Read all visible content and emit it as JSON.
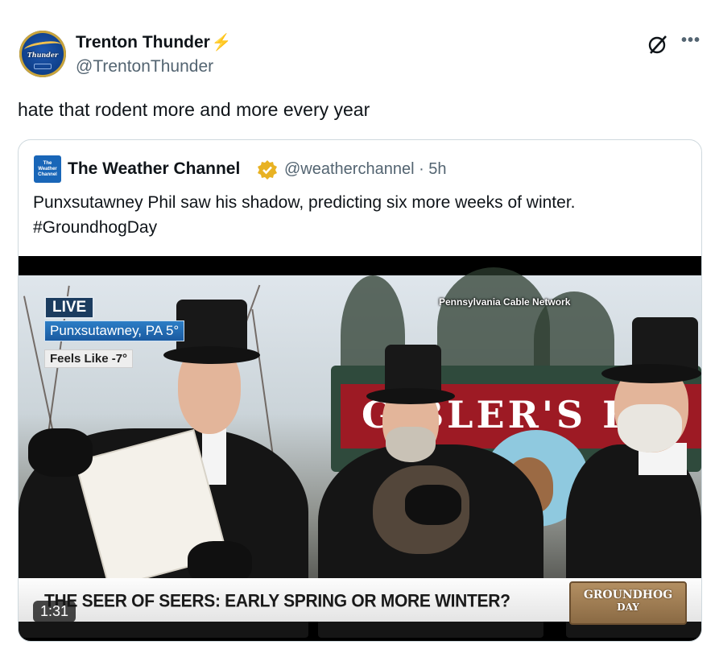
{
  "tweet": {
    "author_name": "Trenton Thunder",
    "author_handle": "@TrentonThunder",
    "avatar_logo_text": "Thunder",
    "name_emoji": "⚡",
    "text": "hate that rodent more and more every year"
  },
  "header_icons": {
    "grok": "grok-icon",
    "more": "more-icon"
  },
  "quoted": {
    "author_name": "The Weather Channel",
    "avatar_text": [
      "The",
      "Weather",
      "Channel"
    ],
    "verified": "verified-badge-icon",
    "handle_time": "@weatherchannel · 5h",
    "text_line1": "Punxsutawney Phil saw his shadow, predicting six more weeks of winter.",
    "text_line2": "#GroundhogDay",
    "video": {
      "live_label": "LIVE",
      "location": "Punxsutawney, PA  5°",
      "feels_like": "Feels Like -7°",
      "network_credit": "Pennsylvania Cable Network",
      "sign_text": "G  BLER'S K",
      "lower_third": "THE SEER OF SEERS: EARLY SPRING OR MORE WINTER?",
      "logo_line1": "GROUNDHOG",
      "logo_line2": "DAY",
      "duration": "1:31"
    }
  },
  "colors": {
    "text": "#0f1419",
    "muted": "#536471",
    "border": "#cfd9de",
    "bolt": "#f5a623",
    "verified": "#e8b223"
  }
}
